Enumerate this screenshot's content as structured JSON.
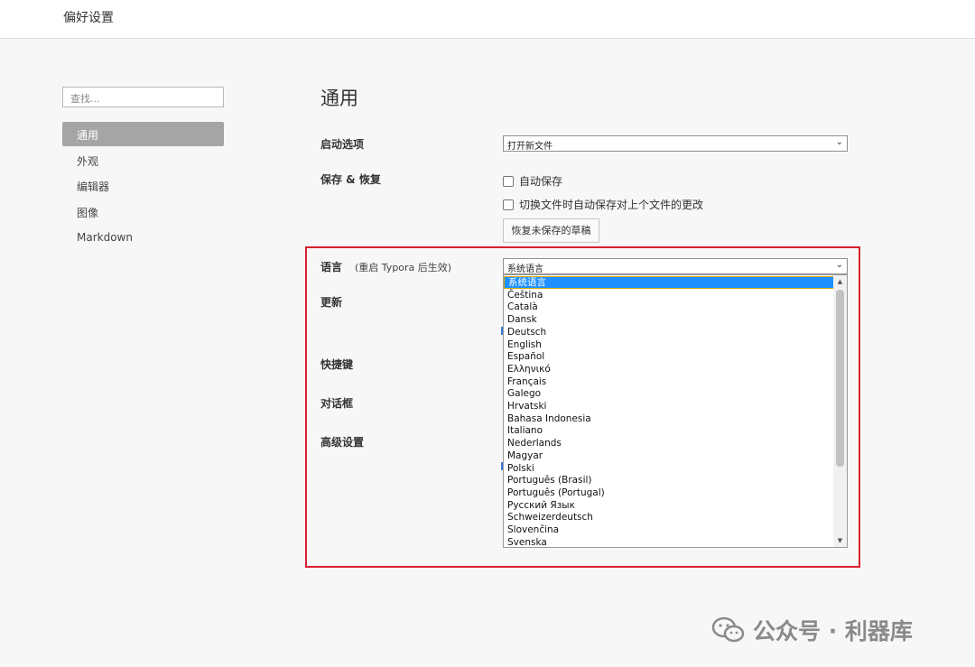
{
  "window": {
    "title": "偏好设置"
  },
  "sidebar": {
    "search_placeholder": "查找...",
    "items": [
      {
        "label": "通用",
        "active": true
      },
      {
        "label": "外观",
        "active": false
      },
      {
        "label": "编辑器",
        "active": false
      },
      {
        "label": "图像",
        "active": false
      },
      {
        "label": "Markdown",
        "active": false
      }
    ]
  },
  "main": {
    "heading": "通用",
    "startup": {
      "label": "启动选项",
      "value": "打开新文件"
    },
    "save_restore": {
      "label": "保存 & 恢复",
      "autosave_label": "自动保存",
      "autosave_on_switch_label": "切换文件时自动保存对上个文件的更改",
      "restore_button": "恢复未保存的草稿"
    },
    "language": {
      "label": "语言",
      "note": "(重启 Typora 后生效)",
      "value": "系统语言",
      "options": [
        "系统语言",
        "Čeština",
        "Català",
        "Dansk",
        "Deutsch",
        "English",
        "Español",
        "Ελληνικό",
        "Français",
        "Galego",
        "Hrvatski",
        "Bahasa Indonesia",
        "Italiano",
        "Nederlands",
        "Magyar",
        "Polski",
        "Português (Brasil)",
        "Português (Portugal)",
        "Русский Язык",
        "Schweizerdeutsch",
        "Slovenčina",
        "Svenska"
      ],
      "selected_index": 0
    },
    "update": {
      "label": "更新"
    },
    "shortcuts": {
      "label": "快捷键"
    },
    "dialog": {
      "label": "对话框"
    },
    "advanced": {
      "label": "高级设置"
    }
  },
  "watermark": {
    "text": "公众号 · 利器库",
    "icon": "wechat-icon"
  },
  "colors": {
    "highlight_border": "#d92030",
    "selected_option": "#1e90ff",
    "active_nav": "#a5a5a5"
  }
}
